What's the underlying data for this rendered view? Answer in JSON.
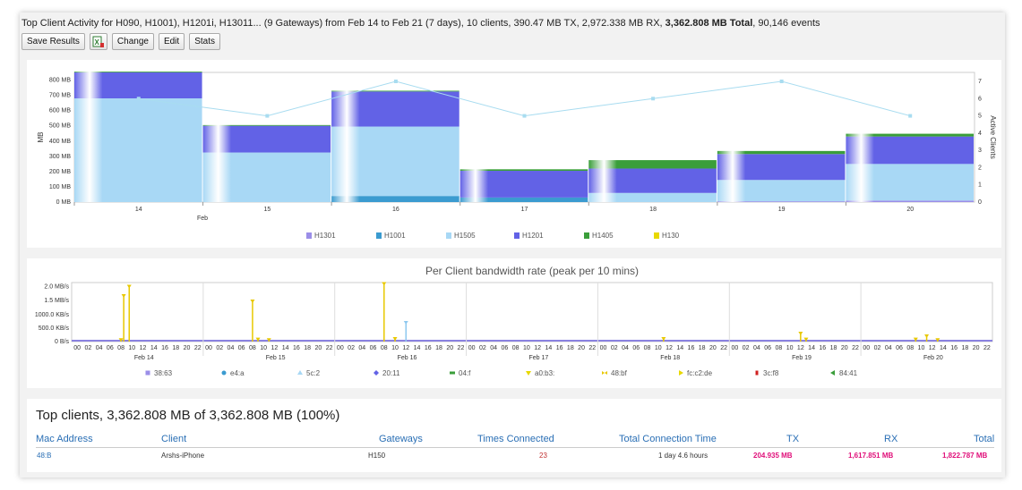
{
  "header": {
    "title_prefix": "Top Client Activity for H090",
    "title_middle_1": ", H1001",
    "title_middle_2": "), H1201",
    "title_middle_3": "i, H13011",
    "title_rest": "... (9 Gateways) from Feb 14 to Feb 21 (7 days), 10 clients, 390.47 MB TX, 2,972.338 MB RX, ",
    "title_total": "3,362.808 MB Total",
    "title_events": ", 90,146 events"
  },
  "toolbar": {
    "save_label": "Save Results",
    "excel_icon": "excel-export-icon",
    "change_label": "Change",
    "edit_label": "Edit",
    "stats_label": "Stats"
  },
  "chart_data": [
    {
      "type": "bar",
      "stacked": true,
      "categories": [
        "14",
        "15",
        "16",
        "17",
        "18",
        "19",
        "20"
      ],
      "x_month_label": "Feb",
      "ylabel": "MB",
      "ylim": [
        0,
        850
      ],
      "yticks": [
        "0 MB",
        "100 MB",
        "200 MB",
        "300 MB",
        "400 MB",
        "500 MB",
        "600 MB",
        "700 MB",
        "800 MB"
      ],
      "y2label": "Active Clients",
      "y2lim": [
        0,
        7
      ],
      "y2ticks": [
        "0",
        "1",
        "2",
        "3",
        "4",
        "5",
        "6",
        "7"
      ],
      "series": [
        {
          "name": "H1301",
          "color": "#9b8ee8",
          "values": [
            0,
            0,
            0,
            0,
            0,
            5,
            10
          ]
        },
        {
          "name": "H1001",
          "color": "#3b9bd0",
          "values": [
            0,
            0,
            40,
            30,
            0,
            0,
            0
          ]
        },
        {
          "name": "H1505",
          "color": "#a8d8f5",
          "values": [
            680,
            325,
            455,
            0,
            60,
            140,
            240
          ]
        },
        {
          "name": "H1201",
          "color": "#6262e6",
          "values": [
            170,
            175,
            230,
            175,
            160,
            170,
            180
          ]
        },
        {
          "name": "H1405",
          "color": "#3a9e3a",
          "values": [
            5,
            5,
            5,
            10,
            55,
            20,
            18
          ]
        },
        {
          "name": "H130",
          "color": "#e8d800",
          "values": [
            0,
            0,
            0,
            0,
            0,
            0,
            0
          ]
        }
      ],
      "line": {
        "values": [
          6,
          5,
          7,
          5,
          6,
          7,
          5
        ],
        "color": "#a8dcf0"
      },
      "legend_position": "bottom"
    },
    {
      "type": "scatter",
      "title": "Per Client bandwidth rate (peak per 10 mins)",
      "yticks": [
        "0 B/s",
        "500.0 KB/s",
        "1000.0 KB/s",
        "1.5 MB/s",
        "2.0 MB/s"
      ],
      "ylim_kbs": [
        0,
        2200
      ],
      "days": [
        "Feb 14",
        "Feb 15",
        "Feb 16",
        "Feb 17",
        "Feb 18",
        "Feb 19",
        "Feb 20"
      ],
      "hour_ticks": [
        "00",
        "02",
        "04",
        "06",
        "08",
        "10",
        "12",
        "14",
        "16",
        "18",
        "20",
        "22"
      ],
      "spikes": [
        {
          "day": 0,
          "hour": 9.5,
          "kbs": 1700,
          "color": "#e8c800"
        },
        {
          "day": 0,
          "hour": 10.5,
          "kbs": 2050,
          "color": "#e8c800"
        },
        {
          "day": 0,
          "hour": 9,
          "kbs": 60,
          "color": "#e8c800"
        },
        {
          "day": 1,
          "hour": 9,
          "kbs": 1500,
          "color": "#e8c800"
        },
        {
          "day": 1,
          "hour": 10,
          "kbs": 80,
          "color": "#e8c800"
        },
        {
          "day": 1,
          "hour": 12,
          "kbs": 60,
          "color": "#e8c800"
        },
        {
          "day": 2,
          "hour": 9,
          "kbs": 2150,
          "color": "#e8c800"
        },
        {
          "day": 2,
          "hour": 11,
          "kbs": 100,
          "color": "#e8c800"
        },
        {
          "day": 2,
          "hour": 13,
          "kbs": 700,
          "color": "#8ec8ef"
        },
        {
          "day": 4,
          "hour": 12,
          "kbs": 100,
          "color": "#e8c800"
        },
        {
          "day": 5,
          "hour": 13,
          "kbs": 300,
          "color": "#e8c800"
        },
        {
          "day": 5,
          "hour": 14,
          "kbs": 80,
          "color": "#e8c800"
        },
        {
          "day": 6,
          "hour": 10,
          "kbs": 80,
          "color": "#e8c800"
        },
        {
          "day": 6,
          "hour": 12,
          "kbs": 200,
          "color": "#e8c800"
        },
        {
          "day": 6,
          "hour": 14,
          "kbs": 60,
          "color": "#e8c800"
        }
      ],
      "legend": [
        {
          "name": "38:63",
          "color": "#9b8ee8",
          "marker": "square"
        },
        {
          "name": "e4:a",
          "color": "#3b9bd0",
          "marker": "circle"
        },
        {
          "name": "5c:2",
          "color": "#a8d8f5",
          "marker": "triangle"
        },
        {
          "name": "20:11",
          "color": "#6262e6",
          "marker": "diamond"
        },
        {
          "name": "04:f",
          "color": "#3a9e3a",
          "marker": "bar"
        },
        {
          "name": "a0:b3:",
          "color": "#e8d800",
          "marker": "triangle-down"
        },
        {
          "name": "48:bf",
          "color": "#e8c800",
          "marker": "bowtie"
        },
        {
          "name": "fc:c2:de",
          "color": "#e8d800",
          "marker": "triangle-right"
        },
        {
          "name": "3c:f8",
          "color": "#d02020",
          "marker": "square-small"
        },
        {
          "name": "84:41",
          "color": "#3a9e3a",
          "marker": "triangle-left"
        }
      ]
    }
  ],
  "top_clients": {
    "title": "Top clients, 3,362.808 MB of 3,362.808 MB (100%)",
    "columns": [
      "Mac Address",
      "Client",
      "Gateways",
      "Times Connected",
      "Total Connection Time",
      "TX",
      "RX",
      "Total"
    ],
    "rows": [
      {
        "mac": "48:B",
        "client": "Arshs-iPhone",
        "gateways": "H150",
        "times": "23",
        "time": "1 day 4.6 hours",
        "tx": "204.935 MB",
        "rx": "1,617.851 MB",
        "total": "1,822.787 MB"
      }
    ]
  }
}
